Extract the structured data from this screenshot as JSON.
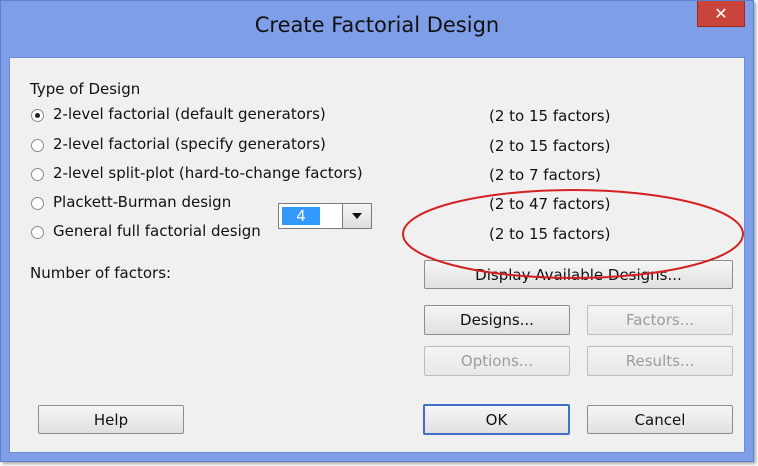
{
  "window": {
    "title": "Create Factorial Design",
    "close_label": "✕"
  },
  "design_type": {
    "heading": "Type of Design",
    "options": [
      {
        "label": "2-level factorial (default generators)",
        "range": "(2 to 15 factors)",
        "selected": true
      },
      {
        "label": "2-level factorial (specify generators)",
        "range": "(2 to 15 factors)",
        "selected": false
      },
      {
        "label": "2-level split-plot (hard-to-change factors)",
        "range": "(2 to 7 factors)",
        "selected": false
      },
      {
        "label": "Plackett-Burman design",
        "range": "(2 to 47 factors)",
        "selected": false
      },
      {
        "label": "General full factorial design",
        "range": "(2 to 15 factors)",
        "selected": false
      }
    ]
  },
  "factors": {
    "label": "Number of factors:",
    "value": "4"
  },
  "buttons": {
    "display_designs": "Display Available Designs...",
    "designs": "Designs...",
    "factors": "Factors...",
    "options": "Options...",
    "results": "Results...",
    "help": "Help",
    "ok": "OK",
    "cancel": "Cancel"
  },
  "colors": {
    "title_bar": "#7e9ee8",
    "close_button": "#c9443b",
    "selection": "#3399ff",
    "annotation": "#d42020"
  }
}
